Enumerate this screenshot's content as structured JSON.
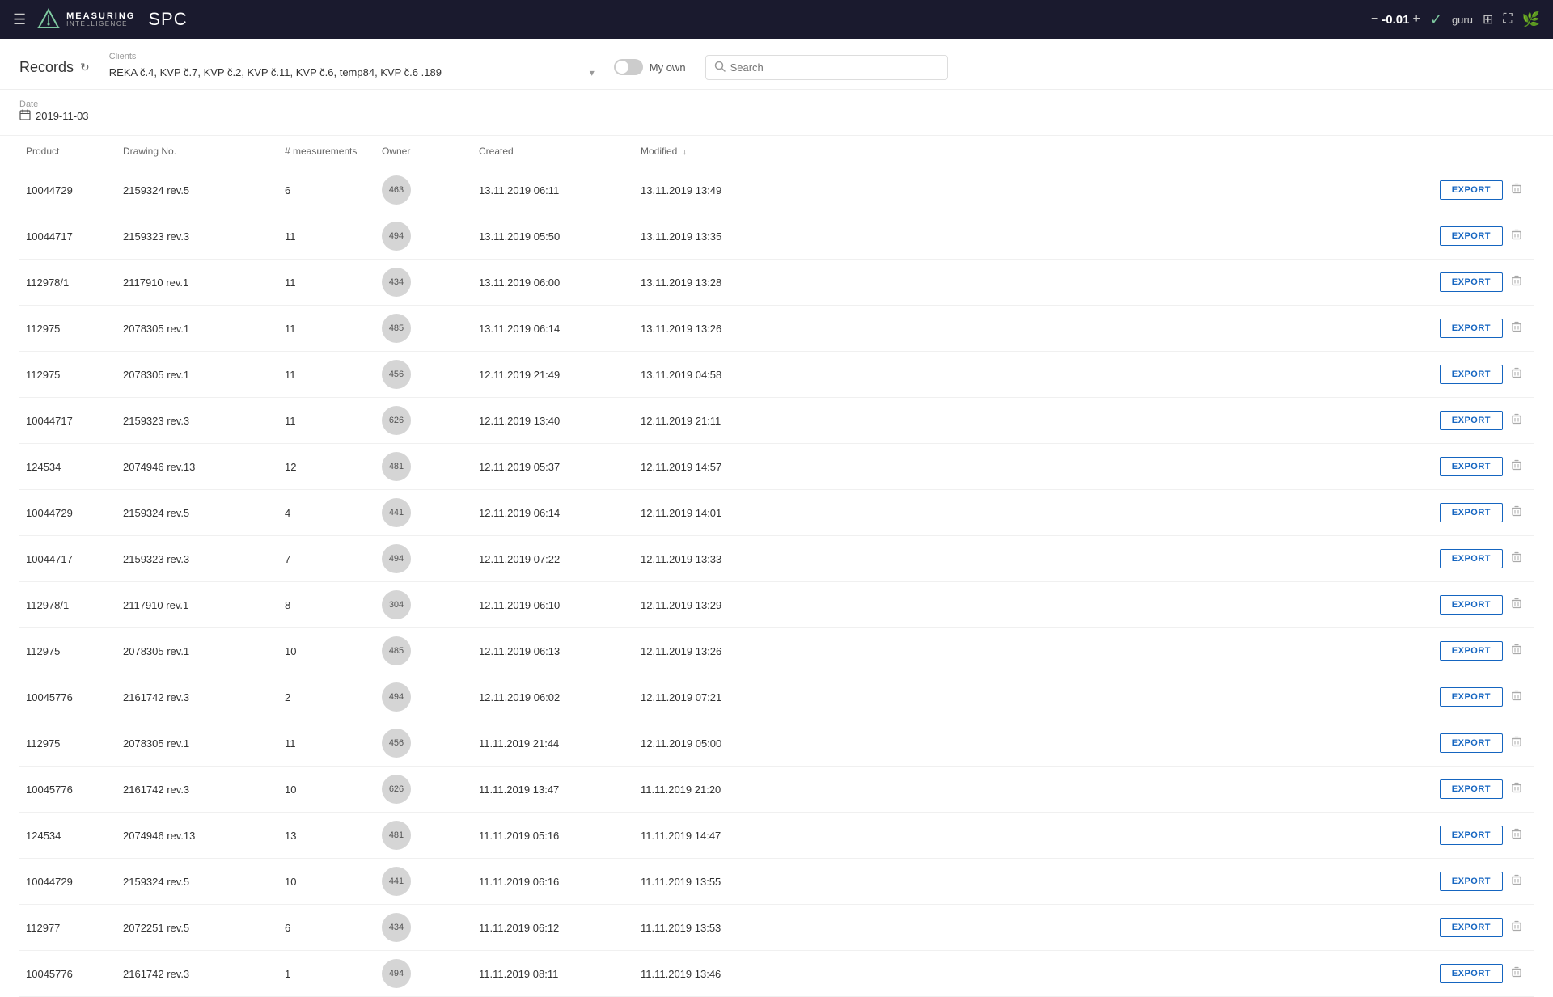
{
  "topbar": {
    "menu_icon": "☰",
    "logo_measuring": "MEASURING",
    "logo_intelligence": "INTELLIGENCE",
    "app_name": "SPC",
    "score_minus": "−",
    "score_value": "-0.01",
    "score_plus": "+",
    "check_icon": "✓",
    "user_name": "guru",
    "login_icon": "⊞",
    "fullscreen_icon": "⛶",
    "plant_icon": "🌿"
  },
  "filters": {
    "records_title": "Records",
    "refresh_icon": "↻",
    "clients_label": "Clients",
    "clients_value": "REKA č.4, KVP č.7, KVP č.2, KVP č.11, KVP č.6, temp84, KVP č.6 .189",
    "dropdown_arrow": "▾",
    "my_own_label": "My own",
    "search_placeholder": "Search"
  },
  "date_section": {
    "label": "Date",
    "value": "2019-11-03"
  },
  "table": {
    "columns": [
      {
        "key": "product",
        "label": "Product",
        "sortable": false
      },
      {
        "key": "drawing",
        "label": "Drawing No.",
        "sortable": false
      },
      {
        "key": "measurements",
        "label": "# measurements",
        "sortable": false
      },
      {
        "key": "owner",
        "label": "Owner",
        "sortable": false
      },
      {
        "key": "created",
        "label": "Created",
        "sortable": false
      },
      {
        "key": "modified",
        "label": "Modified ↓",
        "sortable": true
      },
      {
        "key": "actions",
        "label": "",
        "sortable": false
      }
    ],
    "rows": [
      {
        "product": "10044729",
        "drawing": "2159324 rev.5",
        "measurements": "6",
        "owner": "463",
        "created": "13.11.2019 06:11",
        "modified": "13.11.2019 13:49"
      },
      {
        "product": "10044717",
        "drawing": "2159323 rev.3",
        "measurements": "11",
        "owner": "494",
        "created": "13.11.2019 05:50",
        "modified": "13.11.2019 13:35"
      },
      {
        "product": "112978/1",
        "drawing": "2117910 rev.1",
        "measurements": "11",
        "owner": "434",
        "created": "13.11.2019 06:00",
        "modified": "13.11.2019 13:28"
      },
      {
        "product": "112975",
        "drawing": "2078305 rev.1",
        "measurements": "11",
        "owner": "485",
        "created": "13.11.2019 06:14",
        "modified": "13.11.2019 13:26"
      },
      {
        "product": "112975",
        "drawing": "2078305 rev.1",
        "measurements": "11",
        "owner": "456",
        "created": "12.11.2019 21:49",
        "modified": "13.11.2019 04:58"
      },
      {
        "product": "10044717",
        "drawing": "2159323 rev.3",
        "measurements": "11",
        "owner": "626",
        "created": "12.11.2019 13:40",
        "modified": "12.11.2019 21:11"
      },
      {
        "product": "124534",
        "drawing": "2074946 rev.13",
        "measurements": "12",
        "owner": "481",
        "created": "12.11.2019 05:37",
        "modified": "12.11.2019 14:57"
      },
      {
        "product": "10044729",
        "drawing": "2159324 rev.5",
        "measurements": "4",
        "owner": "441",
        "created": "12.11.2019 06:14",
        "modified": "12.11.2019 14:01"
      },
      {
        "product": "10044717",
        "drawing": "2159323 rev.3",
        "measurements": "7",
        "owner": "494",
        "created": "12.11.2019 07:22",
        "modified": "12.11.2019 13:33"
      },
      {
        "product": "112978/1",
        "drawing": "2117910 rev.1",
        "measurements": "8",
        "owner": "304",
        "created": "12.11.2019 06:10",
        "modified": "12.11.2019 13:29"
      },
      {
        "product": "112975",
        "drawing": "2078305 rev.1",
        "measurements": "10",
        "owner": "485",
        "created": "12.11.2019 06:13",
        "modified": "12.11.2019 13:26"
      },
      {
        "product": "10045776",
        "drawing": "2161742 rev.3",
        "measurements": "2",
        "owner": "494",
        "created": "12.11.2019 06:02",
        "modified": "12.11.2019 07:21"
      },
      {
        "product": "112975",
        "drawing": "2078305 rev.1",
        "measurements": "11",
        "owner": "456",
        "created": "11.11.2019 21:44",
        "modified": "12.11.2019 05:00"
      },
      {
        "product": "10045776",
        "drawing": "2161742 rev.3",
        "measurements": "10",
        "owner": "626",
        "created": "11.11.2019 13:47",
        "modified": "11.11.2019 21:20"
      },
      {
        "product": "124534",
        "drawing": "2074946 rev.13",
        "measurements": "13",
        "owner": "481",
        "created": "11.11.2019 05:16",
        "modified": "11.11.2019 14:47"
      },
      {
        "product": "10044729",
        "drawing": "2159324 rev.5",
        "measurements": "10",
        "owner": "441",
        "created": "11.11.2019 06:16",
        "modified": "11.11.2019 13:55"
      },
      {
        "product": "112977",
        "drawing": "2072251 rev.5",
        "measurements": "6",
        "owner": "434",
        "created": "11.11.2019 06:12",
        "modified": "11.11.2019 13:53"
      },
      {
        "product": "10045776",
        "drawing": "2161742 rev.3",
        "measurements": "1",
        "owner": "494",
        "created": "11.11.2019 08:11",
        "modified": "11.11.2019 13:46"
      }
    ],
    "export_label": "EXPORT",
    "delete_icon": "🗑"
  }
}
